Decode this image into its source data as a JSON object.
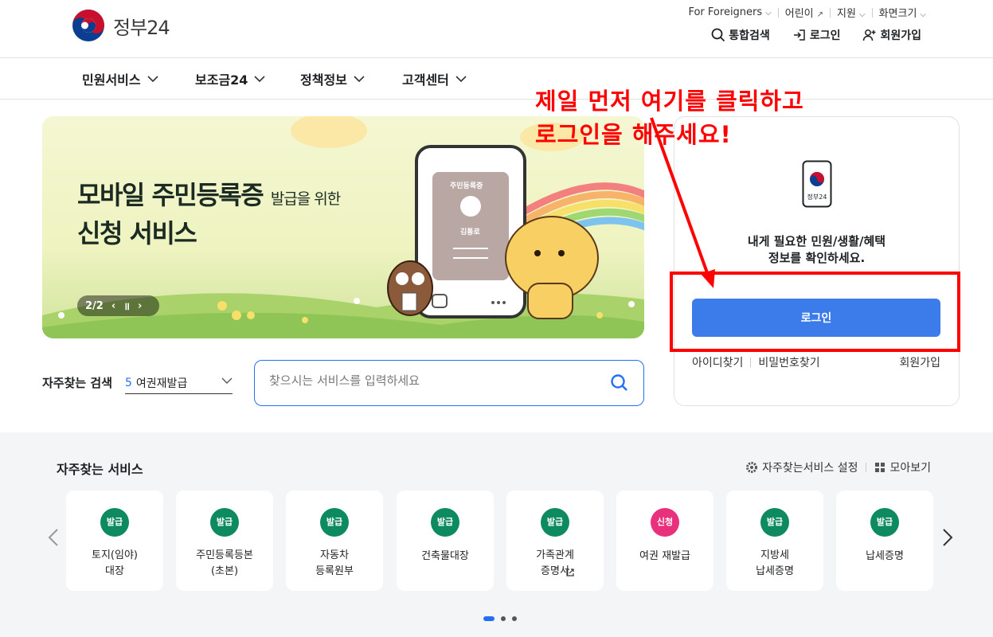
{
  "header": {
    "logo_text": "정부24",
    "util": [
      {
        "label": "For Foreigners",
        "has_chevron": true
      },
      {
        "label": "어린이",
        "has_external": true
      },
      {
        "label": "지원",
        "has_chevron": true
      },
      {
        "label": "화면크기",
        "has_chevron": true
      }
    ],
    "actions": {
      "search": "통합검색",
      "login": "로그인",
      "signup": "회원가입"
    }
  },
  "gnb": [
    "민원서비스",
    "보조금24",
    "정책정보",
    "고객센터"
  ],
  "banner": {
    "title_main": "모바일 주민등록증",
    "title_small": "발급을 위한",
    "title_line2": "신청 서비스",
    "pager": "2/2",
    "phone_card_title": "주민등록증",
    "phone_card_name": "김통로"
  },
  "search": {
    "label": "자주찾는 검색",
    "select_num": "5",
    "select_value": "여권재발급",
    "placeholder": "찾으시는 서비스를 입력하세요"
  },
  "login_card": {
    "phone_label": "정부24",
    "message_line1": "내게 필요한 민원/생활/혜택",
    "message_line2": "정보를 확인하세요.",
    "login_button": "로그인",
    "find_id": "아이디찾기",
    "find_pw": "비밀번호찾기",
    "signup": "회원가입"
  },
  "annotation": {
    "line1": "제일 먼저 여기를 클릭하고",
    "line2": "로그인을 해주세요!",
    "color": "#ff0000"
  },
  "frequent": {
    "title": "자주찾는 서비스",
    "settings": "자주찾는서비스 설정",
    "view_all": "모아보기",
    "items": [
      {
        "badge": "발급",
        "label": "토지(임야)\n대장",
        "color": "#0d8a5f"
      },
      {
        "badge": "발급",
        "label": "주민등록등본\n(초본)",
        "color": "#0d8a5f"
      },
      {
        "badge": "발급",
        "label": "자동차\n등록원부",
        "color": "#0d8a5f"
      },
      {
        "badge": "발급",
        "label": "건축물대장",
        "color": "#0d8a5f"
      },
      {
        "badge": "발급",
        "label": "가족관계\n증명서",
        "color": "#0d8a5f"
      },
      {
        "badge": "신청",
        "label": "여권 재발급",
        "color": "#e8307c"
      },
      {
        "badge": "발급",
        "label": "지방세\n납세증명",
        "color": "#0d8a5f"
      },
      {
        "badge": "발급",
        "label": "납세증명",
        "color": "#0d8a5f"
      }
    ]
  },
  "colors": {
    "primary": "#256ef4",
    "login_button": "#3c7bea",
    "section_bg": "#f4f5f6"
  }
}
